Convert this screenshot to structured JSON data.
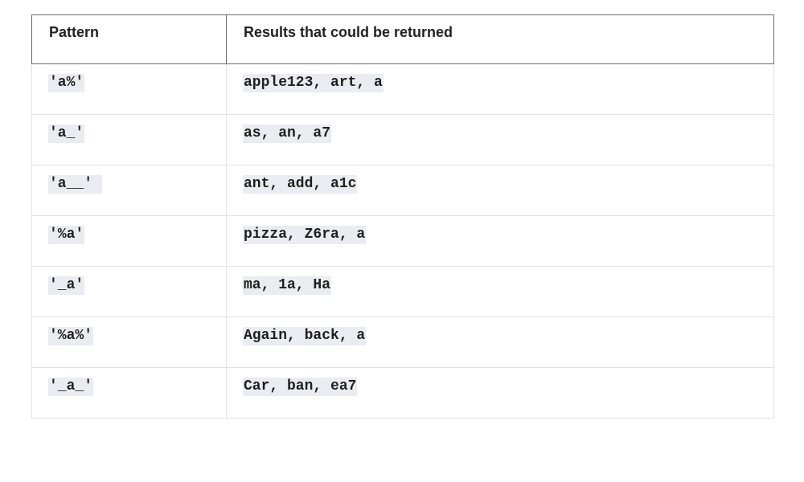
{
  "table": {
    "headers": [
      "Pattern",
      "Results that could be returned"
    ],
    "rows": [
      {
        "pattern": "'a%'",
        "results": "apple123, art, a"
      },
      {
        "pattern": "'a_'",
        "results": "as, an, a7"
      },
      {
        "pattern": "'a__' ",
        "results": "ant, add, a1c"
      },
      {
        "pattern": "'%a'",
        "results": "pizza, Z6ra, a"
      },
      {
        "pattern": "'_a'",
        "results": "ma, 1a, Ha"
      },
      {
        "pattern": "'%a%'",
        "results": "Again, back, a"
      },
      {
        "pattern": "'_a_'",
        "results": "Car, ban, ea7"
      }
    ]
  }
}
